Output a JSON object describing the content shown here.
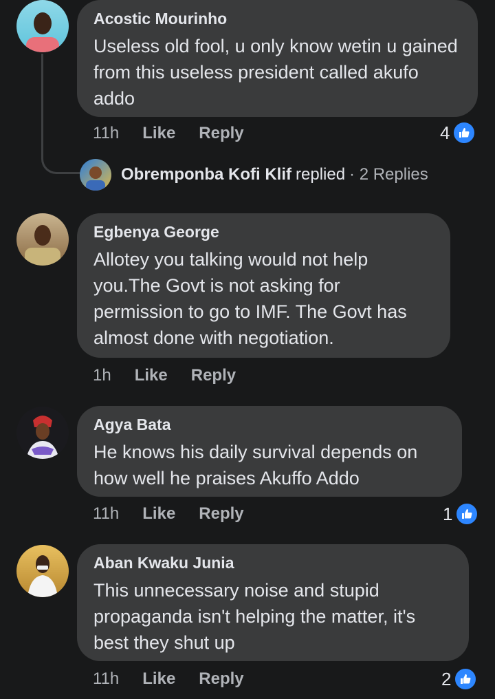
{
  "comments": [
    {
      "author": "Acostic Mourinho",
      "text": "Useless old fool, u only know wetin u gained from this useless president called akufo addo",
      "time": "11h",
      "like_label": "Like",
      "reply_label": "Reply",
      "like_count": "4",
      "avatar_icon": "profile-photo"
    },
    {
      "author": "Egbenya George",
      "text": "Allotey you talking would not help you.The Govt is not asking for permission to go to IMF. The Govt has almost done with negotiation.",
      "time": "1h",
      "like_label": "Like",
      "reply_label": "Reply",
      "avatar_icon": "profile-photo"
    },
    {
      "author": "Agya Bata",
      "text": "He knows his daily survival depends on how well he praises Akuffo Addo",
      "time": "11h",
      "like_label": "Like",
      "reply_label": "Reply",
      "like_count": "1",
      "avatar_icon": "profile-photo"
    },
    {
      "author": "Aban Kwaku Junia",
      "text": "This unnecessary noise and stupid propaganda isn't helping the matter, it's best they shut up",
      "time": "11h",
      "like_label": "Like",
      "reply_label": "Reply",
      "like_count": "2",
      "avatar_icon": "profile-photo"
    }
  ],
  "reply_thread": {
    "author": "Obremponba Kofi Klif",
    "action": "replied",
    "count_text": "· 2 Replies"
  },
  "colors": {
    "background": "#18191a",
    "bubble": "#3a3b3c",
    "like_blue": "#2d86ff",
    "meta_text": "#b0b3b8"
  }
}
